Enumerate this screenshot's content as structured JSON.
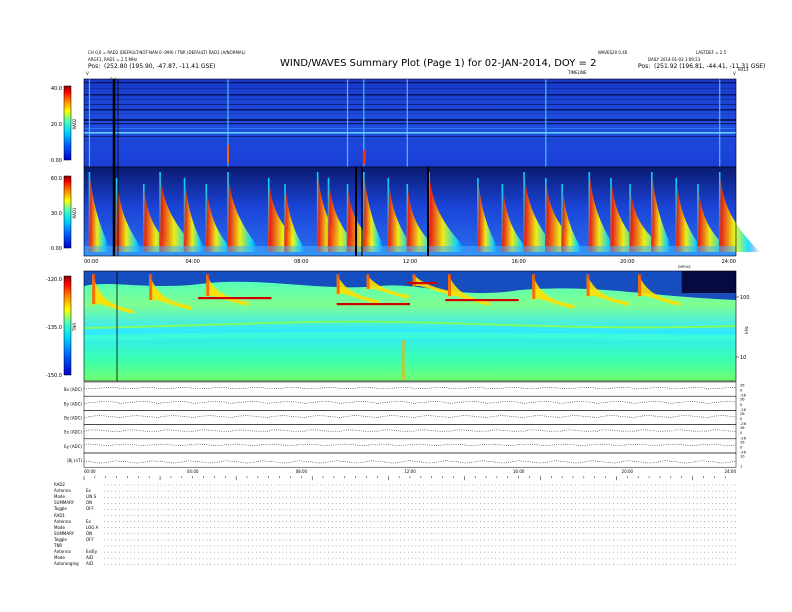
{
  "header": {
    "left_line1": "CH 0,0 = RAD2 (DEFAULT:NOT-NAN 0:-999) / TNR (DEFAULT) RAD1 (A/NORMAL)",
    "left_line2": "ARGF1, RAD1 = 2.5 MHz",
    "left_pos_label": "Pos:",
    "left_pos_value": "(252.80 (195.90, -47.87, -11.41 GSE)",
    "right_line1": "LASTDEF = 2.5",
    "right_line2": "DAILY 2014-01-03 1:09:23",
    "right_pos_label": "Pos:",
    "right_pos_value": "(251.92 (196.81, -44.41, -11.31 GSE)",
    "center_note": "WAVES20 0.40",
    "title": "WIND/WAVES Summary Plot (Page 1) for 02-JAN-2014, DOY = 2",
    "timeline_label": "TIMELINE",
    "corner_left": "V",
    "corner_right": "V",
    "corner_right_num": "6013",
    "cal_label": "Cal"
  },
  "colors": {
    "colorbar": [
      "#0000d0",
      "#0050ff",
      "#00d8ff",
      "#40ffc0",
      "#ffff00",
      "#ff8000",
      "#ff0000",
      "#8b0000"
    ],
    "panel_bg": "#1e3fd0"
  },
  "chart_data": [
    {
      "type": "heatmap",
      "name_label": "RAD2",
      "colorbar_ticks": [
        "40.0",
        "20.0",
        "0.00"
      ],
      "colorbar_range": [
        0,
        40
      ],
      "x_range_hours": [
        0,
        24
      ]
    },
    {
      "type": "heatmap",
      "name_label": "RAD1",
      "colorbar_ticks": [
        "60.0",
        "30.0",
        "0.00"
      ],
      "colorbar_range": [
        0,
        60
      ],
      "x_range_hours": [
        0,
        24
      ],
      "time_ticks": [
        "00:00",
        "04:00",
        "08:00",
        "12:00",
        "16:00",
        "20:00",
        "24:00"
      ],
      "burst_hours": [
        0.2,
        1.2,
        2.2,
        2.8,
        3.7,
        4.5,
        5.3,
        6.8,
        7.4,
        8.6,
        9.0,
        9.7,
        10.3,
        11.2,
        11.9,
        12.7,
        14.5,
        15.4,
        16.2,
        17.0,
        17.6,
        18.6,
        19.4,
        20.1,
        20.9,
        21.8,
        22.6,
        23.4
      ]
    },
    {
      "type": "heatmap",
      "name_label": "TNR",
      "colorbar_ticks": [
        "-120.0",
        "-135.0",
        "-150.0"
      ],
      "colorbar_range": [
        -150,
        -120
      ],
      "right_axis_ticks": [
        "100",
        "10"
      ],
      "right_axis_label": "kHz",
      "x_range_hours": [
        0,
        24
      ]
    },
    {
      "type": "line",
      "traces": [
        {
          "label": "Bx (ADC)",
          "right_ticks": [
            "26",
            "0",
            "-26"
          ]
        },
        {
          "label": "By (ADC)",
          "right_ticks": [
            "26",
            "0",
            "-26"
          ]
        },
        {
          "label": "Bz (ADC)",
          "right_ticks": [
            "26",
            "0",
            "-26"
          ]
        },
        {
          "label": "Ex (ADC)",
          "right_ticks": [
            "26",
            "0",
            "-26"
          ]
        },
        {
          "label": "Ey (ADC)",
          "right_ticks": [
            "26",
            "0",
            "-26"
          ]
        },
        {
          "label": "|B| (nT)",
          "right_ticks": [
            "10",
            "1"
          ]
        }
      ],
      "time_ticks": [
        "00:00",
        "04:00",
        "08:00",
        "12:00",
        "16:00",
        "20:00",
        "24:00"
      ]
    }
  ],
  "status_rows": [
    {
      "label": "RAD2",
      "value": ""
    },
    {
      "label": "Antenna",
      "value": "Ex"
    },
    {
      "label": "Mode",
      "value": "LIN S"
    },
    {
      "label": "SUMMARY",
      "value": "ON"
    },
    {
      "label": "Toggle",
      "value": "OFF"
    },
    {
      "label": "RAD1",
      "value": ""
    },
    {
      "label": "Antenna",
      "value": "Ex"
    },
    {
      "label": "Mode",
      "value": "LOG A"
    },
    {
      "label": "SUMMARY",
      "value": "ON"
    },
    {
      "label": "Toggle",
      "value": "OFF"
    },
    {
      "label": "TNR",
      "value": ""
    },
    {
      "label": "Antenna",
      "value": "Ex/Ey"
    },
    {
      "label": "Mode",
      "value": "A/D"
    },
    {
      "label": "Autoranging",
      "value": "A/D"
    }
  ]
}
